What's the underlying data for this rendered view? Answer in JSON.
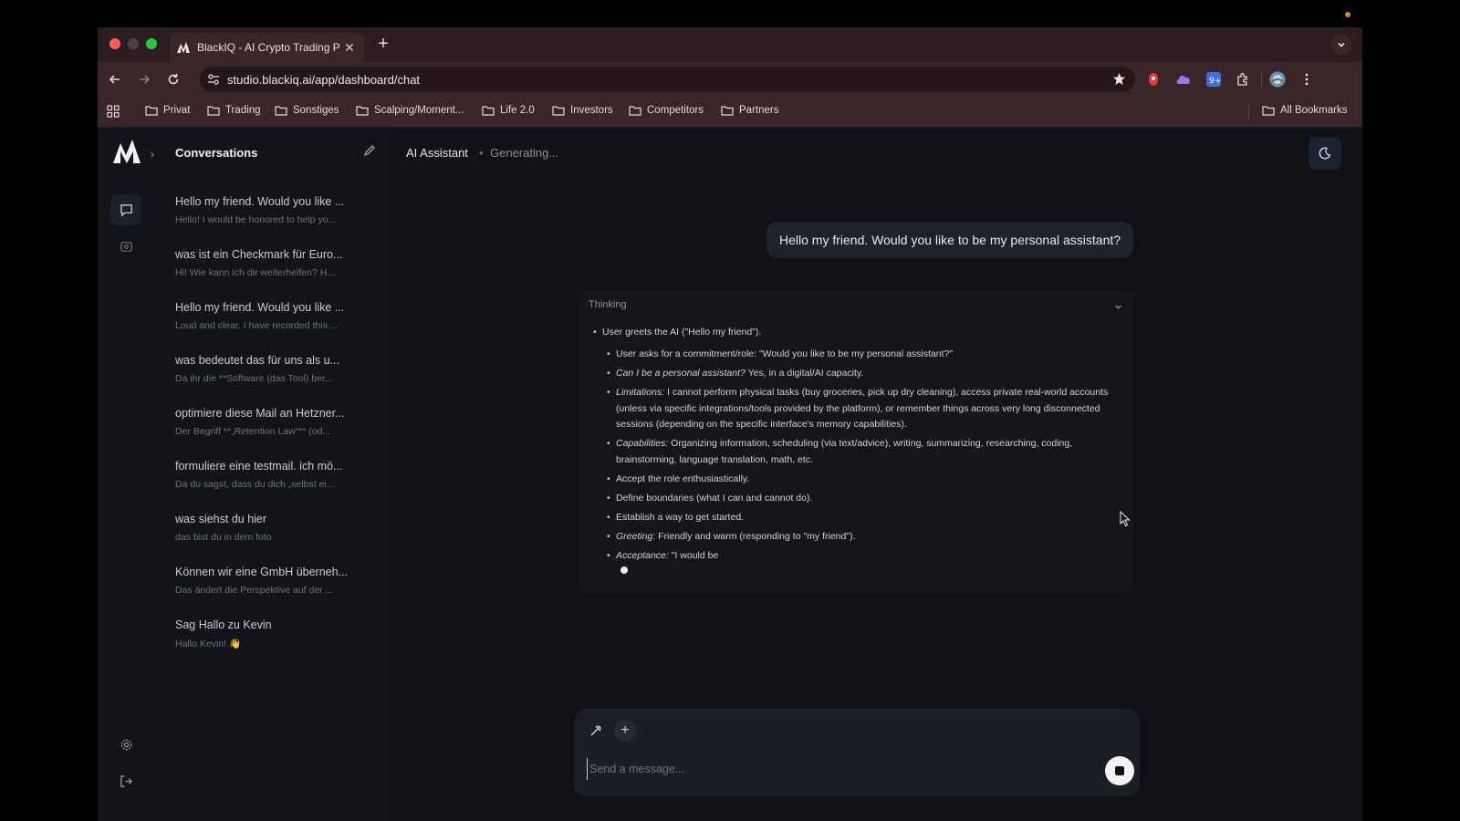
{
  "browser": {
    "tab": {
      "title": "BlackIQ - AI Crypto Trading P",
      "favicon": "blackiq-logo-icon"
    },
    "url": "studio.blackiq.ai/app/dashboard/chat",
    "bookmarks": [
      "Privat",
      "Trading",
      "Sonstiges",
      "Scalping/Moment...",
      "Life 2.0",
      "Investors",
      "Competitors",
      "Partners"
    ],
    "all_bookmarks_label": "All Bookmarks"
  },
  "sidebar": {
    "title": "Conversations",
    "conversations": [
      {
        "title": "Hello my friend. Would you like ...",
        "snippet": "Hello! I would be honored to help yo..."
      },
      {
        "title": "was ist ein Checkmark für Euro...",
        "snippet": "Hi! Wie kann ich dir weiterhelfen? H..."
      },
      {
        "title": "Hello my friend. Would you like ...",
        "snippet": "Loud and clear. I have recorded this ..."
      },
      {
        "title": "was bedeutet das für uns als u...",
        "snippet": "Da ihr die **Software (das Tool) ber..."
      },
      {
        "title": "optimiere diese Mail an Hetzner...",
        "snippet": "Der Begriff **„Retention Law“** (od..."
      },
      {
        "title": "formuliere eine testmail. ich mö...",
        "snippet": "Da du sagst, dass du dich „selbst ei..."
      },
      {
        "title": "was siehst du hier",
        "snippet": "das bist du in dem foto"
      },
      {
        "title": "Können wir eine GmbH überneh...",
        "snippet": "Das ändert die Perspektive auf der ..."
      },
      {
        "title": "Sag Hallo zu Kevin",
        "snippet": "Hallo Kevin! 👋"
      }
    ]
  },
  "header": {
    "title": "AI Assistant",
    "separator": "•",
    "status": "Generating..."
  },
  "chat": {
    "user_message": "Hello my friend. Would you like to be my personal assistant?",
    "thinking": {
      "label": "Thinking",
      "top": "User greets the AI (\"Hello my friend\").",
      "items": [
        {
          "em": "",
          "text": "User asks for a commitment/role: \"Would you like to be my personal assistant?\""
        },
        {
          "em": "Can I be a personal assistant?",
          "text": " Yes, in a digital/AI capacity."
        },
        {
          "em": "Limitations:",
          "text": " I cannot perform physical tasks (buy groceries, pick up dry cleaning), access private real-world accounts (unless via specific integrations/tools provided by the platform), or remember things across very long disconnected sessions (depending on the specific interface's memory capabilities)."
        },
        {
          "em": "Capabilities:",
          "text": " Organizing information, scheduling (via text/advice), writing, summarizing, researching, coding, brainstorming, language translation, math, etc."
        },
        {
          "em": "",
          "text": "Accept the role enthusiastically."
        },
        {
          "em": "",
          "text": "Define boundaries (what I can and cannot do)."
        },
        {
          "em": "",
          "text": "Establish a way to get started."
        },
        {
          "em": "Greeting:",
          "text": " Friendly and warm (responding to \"my friend\")."
        },
        {
          "em": "Acceptance:",
          "text": " \"I would be"
        }
      ]
    }
  },
  "composer": {
    "placeholder": "Send a message..."
  },
  "colors": {
    "accent_tab": "#3a2629",
    "app_bg": "#0f1115",
    "rail_bg": "#121419"
  }
}
